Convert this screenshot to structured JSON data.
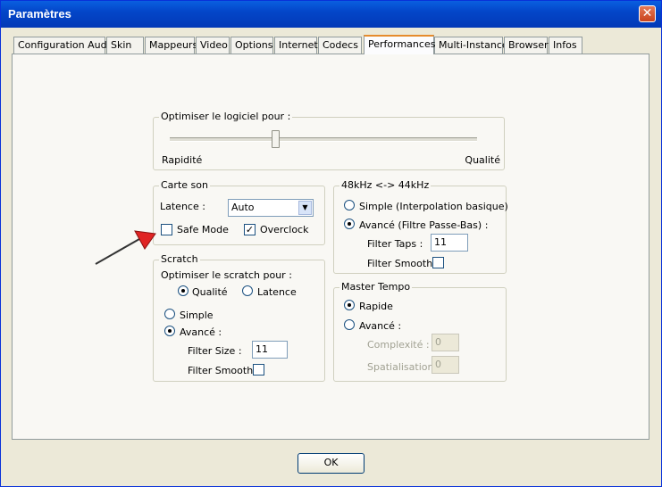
{
  "window": {
    "title": "Paramètres"
  },
  "tabs": [
    "Configuration Audio",
    "Skin",
    "Mappeurs",
    "Video",
    "Options",
    "Internet",
    "Codecs",
    "Performances",
    "Multi-Instance",
    "Browser",
    "Infos"
  ],
  "active_tab": "Performances",
  "optimize": {
    "legend": "Optimiser le logiciel pour :",
    "left_label": "Rapidité",
    "right_label": "Qualité",
    "slider_value": 0.34
  },
  "soundcard": {
    "legend": "Carte son",
    "latency_label": "Latence :",
    "latency_value": "Auto",
    "safe_mode_label": "Safe Mode",
    "safe_mode": false,
    "overclock_label": "Overclock",
    "overclock": true
  },
  "scratch": {
    "legend": "Scratch",
    "optimize_label": "Optimiser le scratch pour :",
    "quality_label": "Qualité",
    "latency_label": "Latence",
    "simple_label": "Simple",
    "advanced_label": "Avancé :",
    "filter_size_label": "Filter Size :",
    "filter_size_value": "11",
    "filter_smooth_label": "Filter Smooth"
  },
  "resample": {
    "legend": "48kHz <-> 44kHz",
    "simple_label": "Simple (Interpolation basique)",
    "advanced_label": "Avancé (Filtre Passe-Bas) :",
    "filter_taps_label": "Filter Taps :",
    "filter_taps_value": "11",
    "filter_smooth_label": "Filter Smooth"
  },
  "master_tempo": {
    "legend": "Master Tempo",
    "fast_label": "Rapide",
    "advanced_label": "Avancé :",
    "complexity_label": "Complexité :",
    "complexity_value": "0",
    "spatialisation_label": "Spatialisation :",
    "spatialisation_value": "0"
  },
  "buttons": {
    "ok": "OK"
  },
  "colors": {
    "title_bar": "#0346c9",
    "arrow_head": "#e02424",
    "tab_accent": "#e68b2c"
  },
  "icons": {
    "close": "close-icon",
    "pointer": "red-arrow-annotation-icon"
  }
}
